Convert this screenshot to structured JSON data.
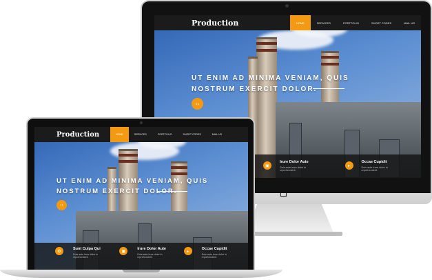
{
  "site": {
    "brand": "Production",
    "menu": [
      "HOME",
      "SERVICES",
      "PORTFOLIO",
      "SHORT CODES",
      "MAIL US"
    ],
    "headline_line1": "UT ENIM AD MINIMA VENIAM, QUIS",
    "headline_line2": "NOSTRUM EXERCIT DOLOR.",
    "toggle_icon": "arrows-icon",
    "accent_color": "#f39a12"
  },
  "imac_features": [
    {
      "title": "Irure Dolor Aute",
      "desc": "Duis aute irure dolor in reprehenderit.",
      "icon": "briefcase-icon"
    },
    {
      "title": "Occae Cupidit",
      "desc": "Duis aute irure dolor in reprehenderit.",
      "icon": "megaphone-icon"
    }
  ],
  "laptop_features": [
    {
      "title": "Sunt Culpa Qui",
      "desc": "Duis aute irure dolor in reprehenderit.",
      "icon": "gear-icon"
    },
    {
      "title": "Irure Dolor Aute",
      "desc": "Duis aute irure dolor in reprehenderit.",
      "icon": "briefcase-icon"
    },
    {
      "title": "Occae Cupidit",
      "desc": "Duis aute irure dolor in reprehenderit.",
      "icon": "megaphone-icon"
    }
  ]
}
